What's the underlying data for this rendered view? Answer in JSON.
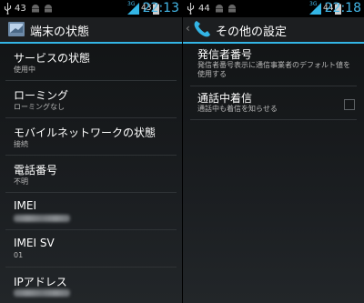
{
  "left": {
    "status": {
      "num1": "43",
      "num2": "43",
      "clock": "22:13",
      "network": "3G"
    },
    "actionbar": {
      "title": "端末の状態"
    },
    "items": [
      {
        "title": "サービスの状態",
        "summary": "使用中"
      },
      {
        "title": "ローミング",
        "summary": "ローミングなし"
      },
      {
        "title": "モバイルネットワークの状態",
        "summary": "接続"
      },
      {
        "title": "電話番号",
        "summary": "不明"
      },
      {
        "title": "IMEI",
        "summary": ""
      },
      {
        "title": "IMEI SV",
        "summary": "01"
      },
      {
        "title": "IPアドレス",
        "summary": ""
      }
    ]
  },
  "right": {
    "status": {
      "num1": "44",
      "num2": "44",
      "clock": "22:18",
      "network": "3G"
    },
    "actionbar": {
      "title": "その他の設定"
    },
    "items": [
      {
        "title": "発信者番号",
        "summary": "発信者番号表示に通信事業者のデフォルト値を使用する"
      },
      {
        "title": "通話中着信",
        "summary": "通話中も着信を知らせる",
        "checked": false
      }
    ]
  },
  "colors": {
    "accent": "#33b5e5",
    "clock": "#44b8e8",
    "background": "#1a1d20"
  },
  "icons": {
    "app_left": "device-info-icon",
    "app_right": "phone-icon"
  }
}
